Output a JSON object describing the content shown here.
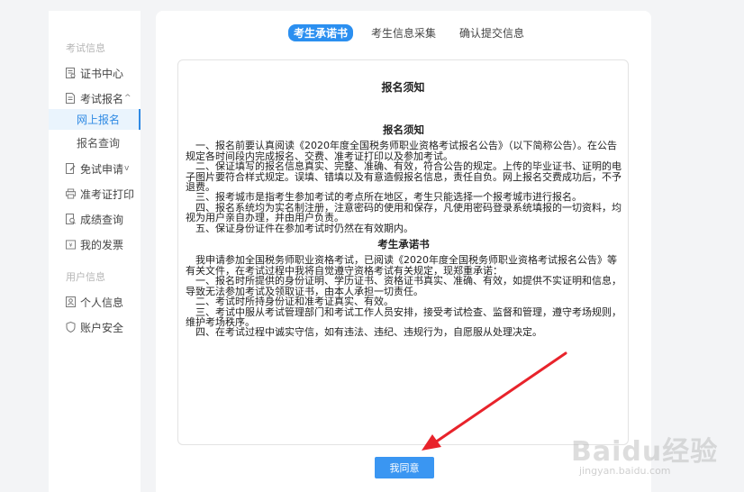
{
  "sidebar": {
    "group1_title": "考试信息",
    "items": [
      {
        "label": "证书中心",
        "icon": "certificate-icon"
      },
      {
        "label": "考试报名",
        "icon": "signup-doc-icon"
      },
      {
        "label": "网上报名"
      },
      {
        "label": "报名查询"
      },
      {
        "label": "免试申请",
        "icon": "exempt-apply-icon"
      },
      {
        "label": "准考证打印",
        "icon": "printer-icon"
      },
      {
        "label": "成绩查询",
        "icon": "score-query-icon"
      },
      {
        "label": "我的发票",
        "icon": "invoice-icon"
      }
    ],
    "group2_title": "用户信息",
    "user_items": [
      {
        "label": "个人信息",
        "icon": "user-icon"
      },
      {
        "label": "账户安全",
        "icon": "shield-icon"
      }
    ]
  },
  "tabs": [
    "考生承诺书",
    "考生信息采集",
    "确认提交信息"
  ],
  "notice": {
    "heading": "报名须知",
    "section1_title": "报名须知",
    "section1_paragraphs": [
      "　一、报名前要认真阅读《2020年度全国税务师职业资格考试报名公告》（以下简称公告）。在公告规定各时间段内完成报名、交费、准考证打印以及参加考试。",
      "　二、保证填写的报名信息真实、完整、准确、有效，符合公告的规定。上传的毕业证书、证明的电子图片要符合样式规定。误填、错填以及有意造假报名信息，责任自负。网上报名交费成功后，不予退费。",
      "　三、报考城市是指考生参加考试的考点所在地区，考生只能选择一个报考城市进行报名。",
      "　四、报名系统均为实名制注册，注意密码的使用和保存，凡使用密码登录系统填报的一切资料，均视为用户亲自办理，并由用户负责。",
      "　五、保证身份证件在参加考试时仍然在有效期内。"
    ],
    "section2_title": "考生承诺书",
    "section2_paragraphs": [
      "　我申请参加全国税务师职业资格考试，已阅读《2020年度全国税务师职业资格考试报名公告》等有关文件，在考试过程中我将自觉遵守资格考试有关规定，现郑重承诺：",
      "　一、报名时所提供的身份证明、学历证书、资格证书真实、准确、有效，如提供不实证明和信息，导致无法参加考试及领取证书，由本人承担一切责任。",
      "　二、考试时所持身份证和准考证真实、有效。",
      "　三、考试中服从考试管理部门和考试工作人员安排，接受考试检查、监督和管理，遵守考场规则，维护考场秩序。",
      "　四、在考试过程中诚实守信，如有违法、违纪、违规行为，自愿服从处理决定。"
    ]
  },
  "agree_button": "我同意",
  "watermark": {
    "main": "Baidu经验",
    "sub": "jingyan.baidu.com"
  },
  "colors": {
    "accent": "#2b8ff0",
    "arrow": "#e8232b",
    "active_bg": "#eaf4fd"
  }
}
